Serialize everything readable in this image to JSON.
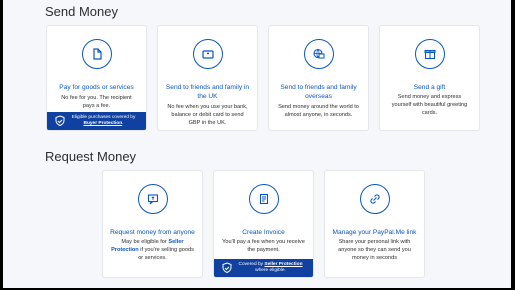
{
  "send": {
    "title": "Send Money",
    "cards": [
      {
        "icon": "document-icon",
        "title": "Pay for goods or services",
        "desc": "No fee for you. The recipient pays a fee.",
        "banner_pre": "Eligible purchases covered by ",
        "banner_link": "Buyer Protection",
        "banner_post": "."
      },
      {
        "icon": "bank-card-icon",
        "title": "Send to friends and family in the UK",
        "desc": "No fee when you use your bank, balance or debit card to send GBP in the UK."
      },
      {
        "icon": "globe-icon",
        "title": "Send to friends and family overseas",
        "desc": "Send money around the world to almost anyone, in seconds."
      },
      {
        "icon": "gift-icon",
        "title": "Send a gift",
        "desc": "Send money and express yourself with beautiful greeting cards."
      }
    ]
  },
  "request": {
    "title": "Request Money",
    "cards": [
      {
        "icon": "request-message-icon",
        "title": "Request money from anyone",
        "desc_pre": "May be eligible for ",
        "desc_bold": "Seller Protection",
        "desc_post": " if you're selling goods or services."
      },
      {
        "icon": "invoice-icon",
        "title": "Create Invoice",
        "desc": "You'll pay a fee when you receive the payment.",
        "banner_pre": "Covered by ",
        "banner_link": "Seller Protection",
        "banner_post": " where eligible."
      },
      {
        "icon": "link-icon",
        "title": "Manage your PayPal.Me link",
        "desc": "Share your personal link with anyone so they can send you money in seconds"
      }
    ]
  },
  "colors": {
    "accent": "#0a56c2",
    "banner": "#1040a0",
    "background": "#f5f7fa"
  }
}
